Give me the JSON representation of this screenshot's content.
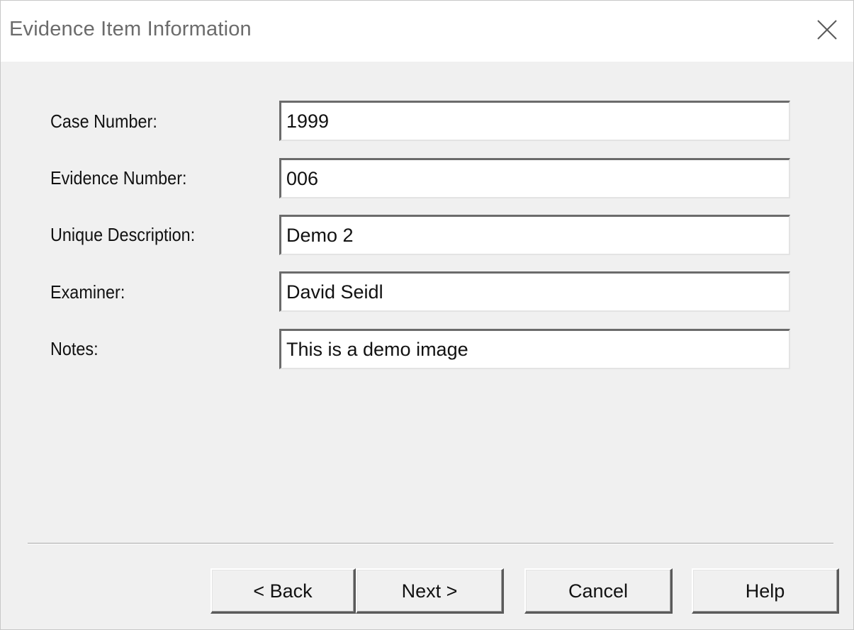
{
  "window": {
    "title": "Evidence Item Information",
    "close_icon": "close-icon"
  },
  "form": {
    "fields": [
      {
        "label": "Case Number:",
        "value": "1999"
      },
      {
        "label": "Evidence Number:",
        "value": "006"
      },
      {
        "label": "Unique Description:",
        "value": "Demo 2"
      },
      {
        "label": "Examiner:",
        "value": "David Seidl"
      },
      {
        "label": "Notes:",
        "value": "This is a demo image"
      }
    ]
  },
  "buttons": {
    "back": "< Back",
    "next": "Next >",
    "cancel": "Cancel",
    "help": "Help"
  },
  "colors": {
    "dialog_background": "#f0f0f0",
    "titlebar_background": "#ffffff",
    "title_text": "#6b6b6b",
    "input_background": "#ffffff"
  }
}
